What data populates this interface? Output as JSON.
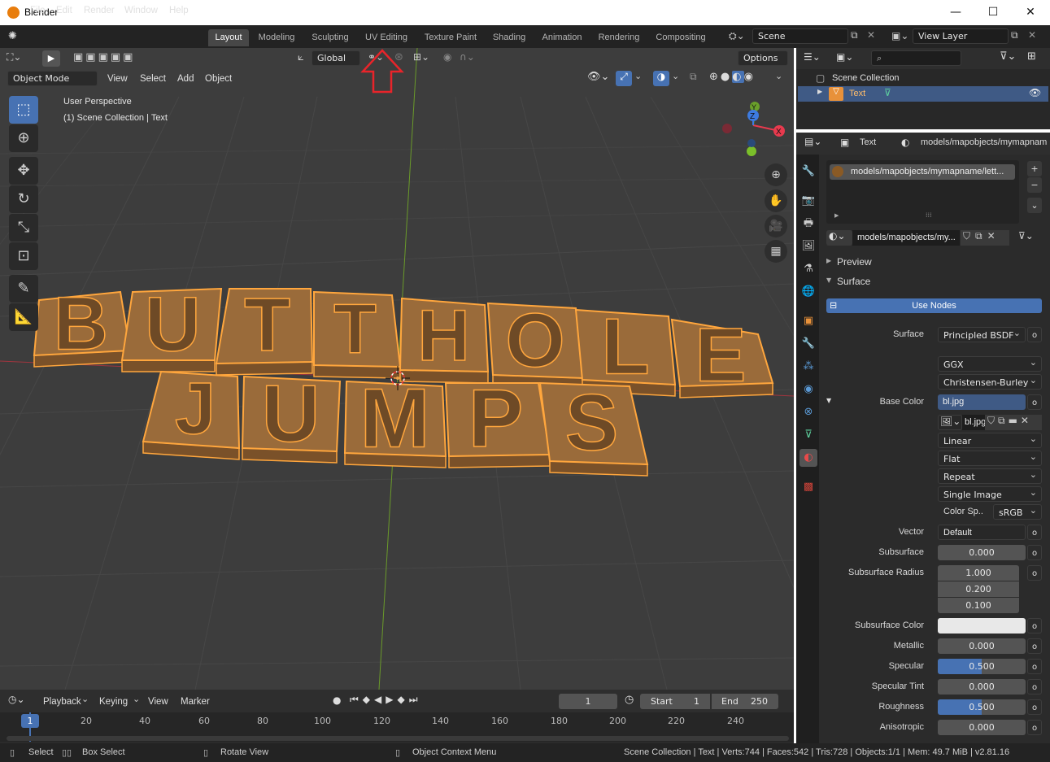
{
  "window": {
    "title": "Blender",
    "min": "—",
    "max": "☐",
    "close": "✕"
  },
  "menu": [
    "File",
    "Edit",
    "Render",
    "Window",
    "Help"
  ],
  "workspaces": [
    "Layout",
    "Modeling",
    "Sculpting",
    "UV Editing",
    "Texture Paint",
    "Shading",
    "Animation",
    "Rendering",
    "Compositing"
  ],
  "scene": {
    "name": "Scene",
    "view_layer": "View Layer"
  },
  "viewport": {
    "transform_orientation": "Global",
    "options": "Options",
    "mode": "Object Mode",
    "menus": [
      "View",
      "Select",
      "Add",
      "Object"
    ],
    "info_line1": "User Perspective",
    "info_line2": "(1) Scene Collection | Text",
    "gizmo": {
      "x": "X",
      "y": "Y",
      "z": "Z"
    },
    "text_row1": [
      "B",
      "U",
      "T",
      "T",
      "H",
      "O",
      "L",
      "E"
    ],
    "text_row2": [
      "J",
      "U",
      "M",
      "P",
      "S"
    ]
  },
  "outliner": {
    "collection": "Scene Collection",
    "object": "Text"
  },
  "properties": {
    "object_name": "Text",
    "material_path": "models/mapobjects/mymapnam",
    "slot_name": "models/mapobjects/mymapname/lett...",
    "material_field": "models/mapobjects/my...",
    "preview": "Preview",
    "surface_panel": "Surface",
    "use_nodes": "Use Nodes",
    "surface_label": "Surface",
    "surface_value": "Principled BSDF",
    "distribution": "GGX",
    "sss_method": "Christensen-Burley",
    "base_color_label": "Base Color",
    "base_color_value": "bl.jpg",
    "image_name": "bl.jpg",
    "interpolation": "Linear",
    "projection": "Flat",
    "extension": "Repeat",
    "source": "Single Image",
    "color_space_label": "Color Sp..",
    "color_space_value": "sRGB",
    "vector_label": "Vector",
    "vector_value": "Default",
    "subsurface_label": "Subsurface",
    "subsurface_value": "0.000",
    "ss_radius_label": "Subsurface Radius",
    "ss_radius": [
      "1.000",
      "0.200",
      "0.100"
    ],
    "ss_color_label": "Subsurface Color",
    "metallic_label": "Metallic",
    "metallic_value": "0.000",
    "specular_label": "Specular",
    "specular_value": "0.500",
    "specular_fraction": 0.5,
    "spec_tint_label": "Specular Tint",
    "spec_tint_value": "0.000",
    "roughness_label": "Roughness",
    "roughness_value": "0.500",
    "roughness_fraction": 0.5,
    "anisotropic_label": "Anisotropic",
    "anisotropic_value": "0.000"
  },
  "timeline": {
    "menus": [
      "Playback",
      "Keying",
      "View",
      "Marker"
    ],
    "current_frame": "1",
    "start_label": "Start",
    "start_value": "1",
    "end_label": "End",
    "end_value": "250",
    "ticks": [
      "1",
      "20",
      "40",
      "60",
      "80",
      "100",
      "120",
      "140",
      "160",
      "180",
      "200",
      "220",
      "240"
    ]
  },
  "status": {
    "select": "Select",
    "box_select": "Box Select",
    "rotate_view": "Rotate View",
    "context_menu": "Object Context Menu",
    "stats": "Scene Collection | Text | Verts:744 | Faces:542 | Tris:728 | Objects:1/1 | Mem: 49.7 MiB | v2.81.16"
  },
  "colors": {
    "accent": "#4772b3",
    "selection": "#ffa63d",
    "annotation": "#e8242a",
    "object_fill": "#9a6b3a"
  }
}
